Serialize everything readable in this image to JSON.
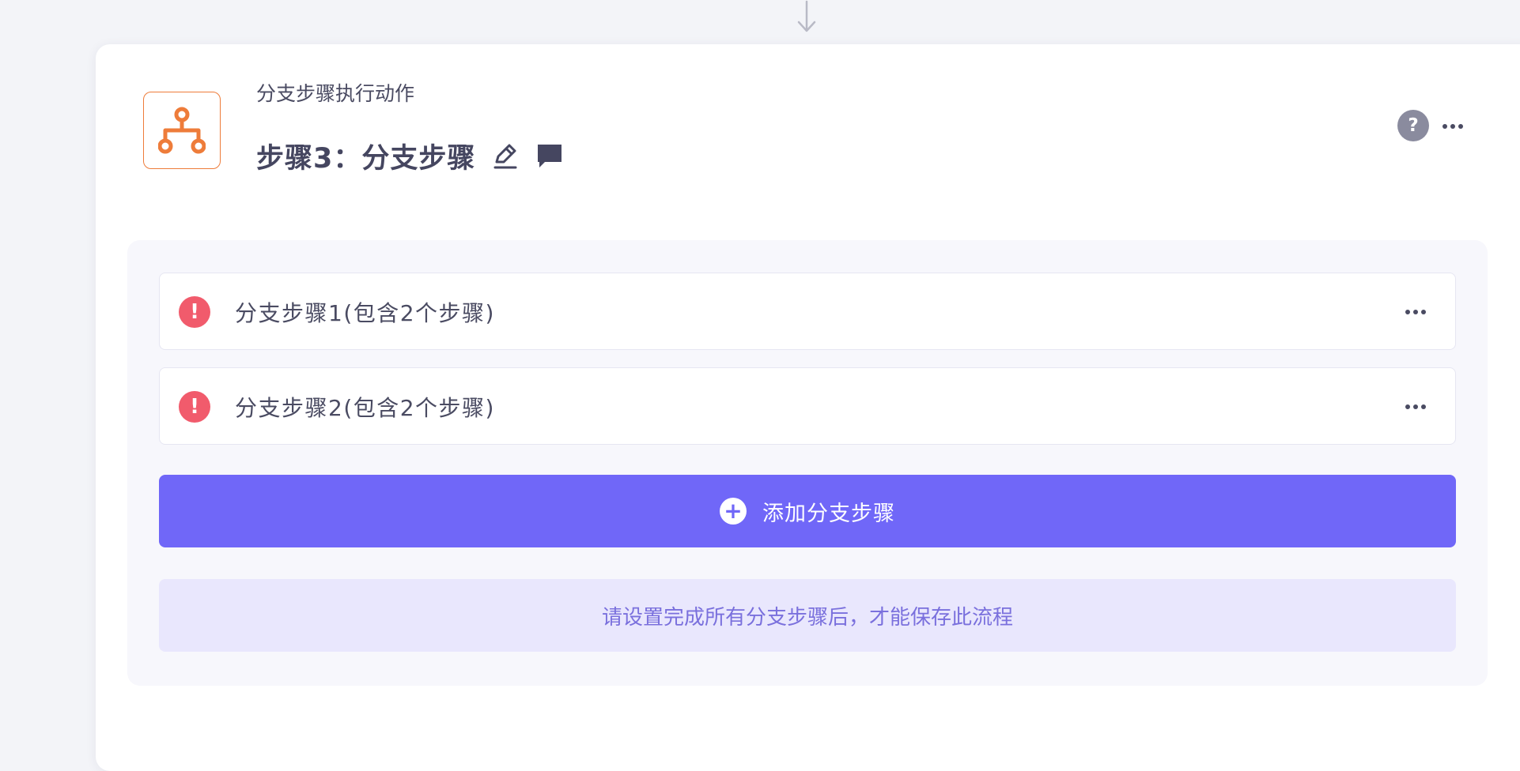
{
  "colors": {
    "accent": "#7067f8",
    "icon_orange": "#ee7c3a",
    "warning_red": "#f15b6c",
    "notice_bg": "#e9e7fd",
    "notice_text": "#7a70dd"
  },
  "flow": {
    "connector_icon": "arrow-down-icon"
  },
  "step": {
    "icon": "branch-icon",
    "type_label": "分支步骤执行动作",
    "title": "步骤3：分支步骤",
    "edit_icon": "pencil-icon",
    "comment_icon": "comment-icon",
    "help_text": "?",
    "more_icon": "more-horizontal-icon"
  },
  "branches": [
    {
      "label": "分支步骤1(包含2个步骤)",
      "status_icon": "warning-icon",
      "status_glyph": "!"
    },
    {
      "label": "分支步骤2(包含2个步骤)",
      "status_icon": "warning-icon",
      "status_glyph": "!"
    }
  ],
  "add_branch": {
    "icon": "plus-circle-icon",
    "icon_glyph": "+",
    "label": "添加分支步骤"
  },
  "notice": {
    "text": "请设置完成所有分支步骤后，才能保存此流程"
  }
}
